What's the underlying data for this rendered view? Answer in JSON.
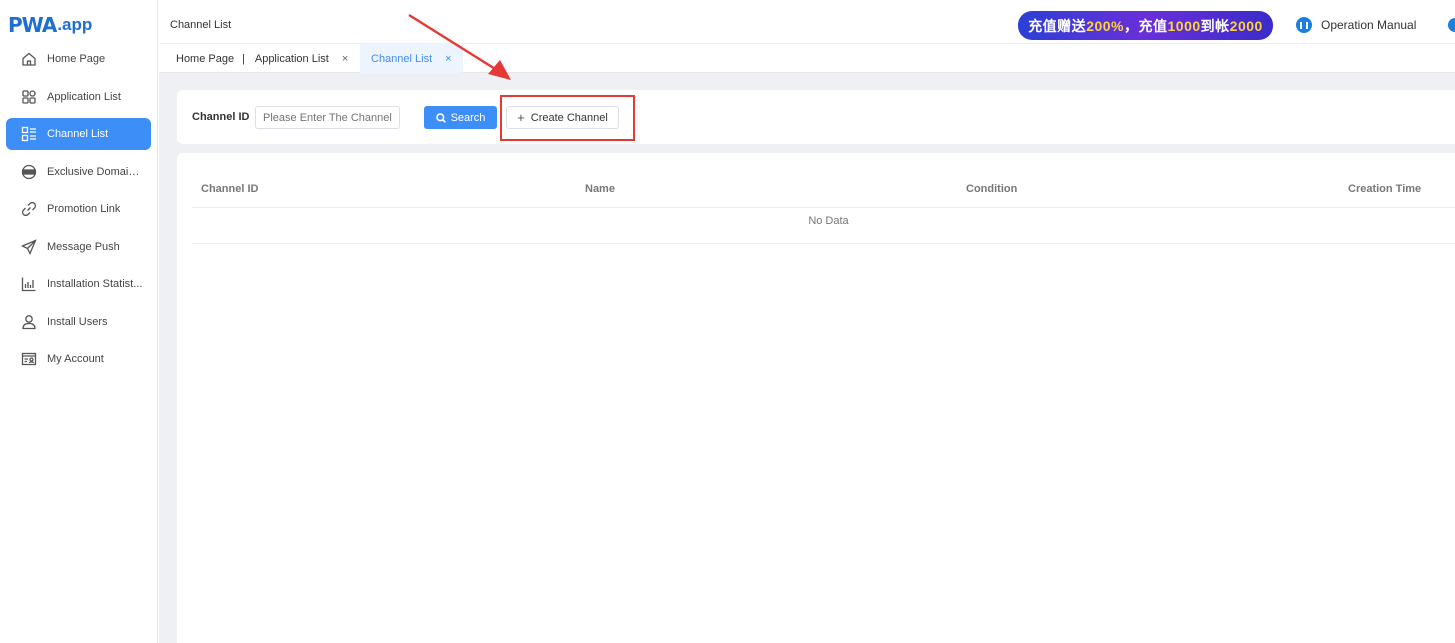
{
  "brand": {
    "logo_mark": "PWA",
    "logo_suffix": ".app"
  },
  "sidebar": {
    "items": [
      {
        "label": "Home Page",
        "icon": "home-icon",
        "active": false
      },
      {
        "label": "Application List",
        "icon": "grid-icon",
        "active": false
      },
      {
        "label": "Channel List",
        "icon": "list-icon",
        "active": true
      },
      {
        "label": "Exclusive Domain...",
        "icon": "dns-icon",
        "active": false
      },
      {
        "label": "Promotion Link",
        "icon": "link-icon",
        "active": false
      },
      {
        "label": "Message Push",
        "icon": "send-icon",
        "active": false
      },
      {
        "label": "Installation Statist...",
        "icon": "bar-chart-icon",
        "active": false
      },
      {
        "label": "Install Users",
        "icon": "user-icon",
        "active": false
      },
      {
        "label": "My Account",
        "icon": "account-card-icon",
        "active": false
      }
    ]
  },
  "header": {
    "breadcrumb": "Channel List",
    "promo": {
      "part1": "充值赠送",
      "part2": "200%",
      "part3": "，充值",
      "part4": "1000",
      "part5": "到帐",
      "part6": "2000"
    },
    "manual_label": "Operation Manual"
  },
  "tabs": [
    {
      "label": "Home Page",
      "closable": false
    },
    {
      "label": "Application List",
      "closable": true,
      "close_glyph": "×"
    },
    {
      "label": "Channel List",
      "closable": true,
      "active": true,
      "close_glyph": "×"
    }
  ],
  "filter": {
    "channel_id_label": "Channel ID",
    "channel_id_placeholder": "Please Enter The Channel I",
    "channel_id_value": "",
    "search_label": "Search",
    "create_label": "Create Channel",
    "create_glyph": "+"
  },
  "table": {
    "columns": [
      "Channel ID",
      "Name",
      "Condition",
      "Creation Time"
    ],
    "rows": [],
    "empty_text": "No Data"
  },
  "colors": {
    "accent": "#3d8ef7",
    "annotation": "#e53935",
    "brand": "#1f6fd1"
  }
}
